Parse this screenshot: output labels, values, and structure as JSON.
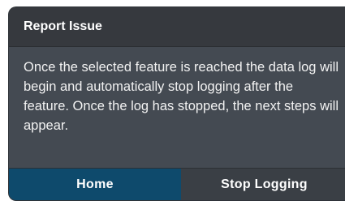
{
  "dialog": {
    "title": "Report Issue",
    "message": "Once the selected feature is reached the data log will begin and automatically stop logging after the feature. Once the log has stopped, the next steps will appear.",
    "buttons": {
      "home_label": "Home",
      "stop_logging_label": "Stop Logging"
    }
  },
  "colors": {
    "header_bg": "#36393e",
    "body_bg": "#444a52",
    "primary_button_bg": "#0e4a6c",
    "secondary_button_bg": "#3a3f45",
    "text": "#ffffff"
  }
}
